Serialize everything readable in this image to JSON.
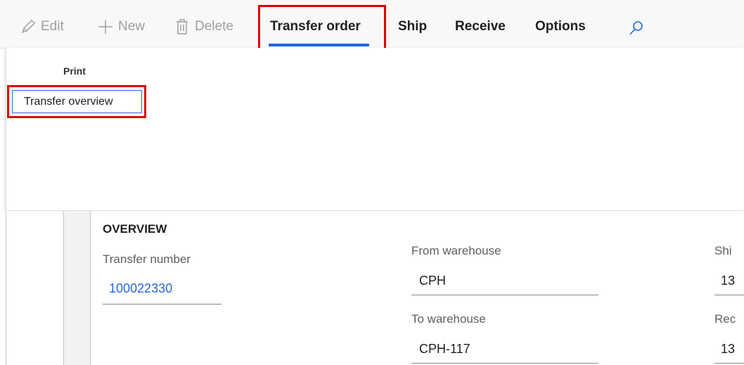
{
  "actionpane": {
    "edit_label": "Edit",
    "new_label": "New",
    "delete_label": "Delete",
    "tabs": [
      {
        "label": "Transfer order",
        "selected": true
      },
      {
        "label": "Ship"
      },
      {
        "label": "Receive"
      },
      {
        "label": "Options"
      }
    ],
    "icons": {
      "edit": "pencil-icon",
      "new": "plus-icon",
      "delete": "trash-icon",
      "search": "search-icon"
    },
    "accent_color": "#2266e3",
    "highlight_color": "#e00000"
  },
  "ribbon": {
    "group_label": "Print",
    "button_label": "Transfer overview"
  },
  "form": {
    "section_title": "OVERVIEW",
    "transfer_number_label": "Transfer number",
    "transfer_number_value": "100022330",
    "from_warehouse_label": "From warehouse",
    "from_warehouse_value": "CPH",
    "to_warehouse_label": "To warehouse",
    "to_warehouse_value": "CPH-117",
    "ship_label": "Shi",
    "ship_value": "13",
    "receive_label": "Rec",
    "receive_value": "13"
  }
}
